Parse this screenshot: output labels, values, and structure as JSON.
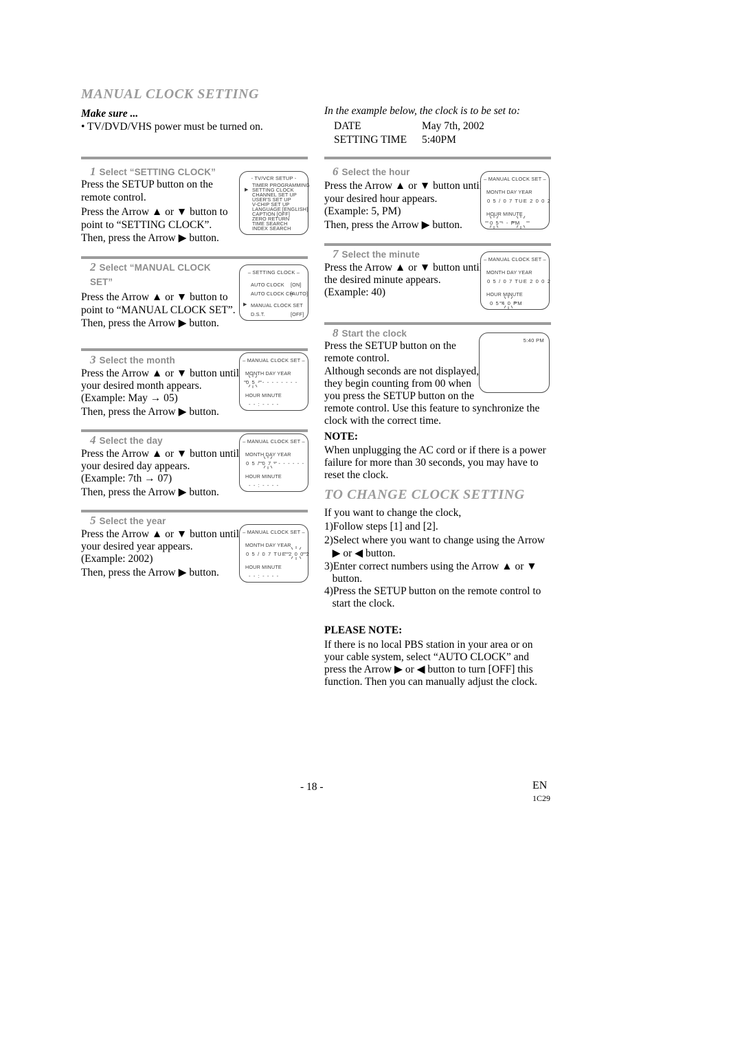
{
  "document": {
    "section_title": "MANUAL CLOCK SETTING",
    "make_sure_label": "Make sure ...",
    "make_sure_bullet": "• TV/DVD/VHS power must be turned on.",
    "example_lead": "In the example below, the clock is to be set to:",
    "example_rows": [
      {
        "label": "DATE",
        "value": "May 7th, 2002"
      },
      {
        "label": "SETTING TIME",
        "value": "5:40PM"
      }
    ]
  },
  "steps": [
    {
      "num": "1",
      "label": "Select “SETTING CLOCK”",
      "label_cont": "",
      "lines": [
        "Press the SETUP button on the",
        "remote control.",
        "Press the Arrow ▲ or ▼ button to",
        "point to “SETTING CLOCK”.",
        "Then, press the Arrow ▶ button."
      ]
    },
    {
      "num": "2",
      "label": "Select “MANUAL CLOCK",
      "label_cont": "SET”",
      "lines": [
        "Press the Arrow ▲ or ▼ button to",
        "point to “MANUAL CLOCK SET”.",
        "Then, press the Arrow ▶ button."
      ]
    },
    {
      "num": "3",
      "label": "Select the month",
      "label_cont": "",
      "lines": [
        "Press the Arrow ▲ or ▼ button until",
        "your desired month appears.",
        "(Example: May → 05)",
        "Then, press the Arrow ▶ button."
      ]
    },
    {
      "num": "4",
      "label": "Select the day",
      "label_cont": "",
      "lines": [
        "Press the Arrow ▲ or ▼ button until",
        "your desired day appears.",
        "(Example: 7th → 07)",
        "Then, press the Arrow ▶ button."
      ]
    },
    {
      "num": "5",
      "label": "Select the year",
      "label_cont": "",
      "lines": [
        "Press the Arrow ▲ or ▼ button until",
        "your desired year appears.",
        "(Example: 2002)",
        "Then, press the Arrow ▶ button."
      ]
    },
    {
      "num": "6",
      "label": "Select the hour",
      "label_cont": "",
      "lines": [
        "Press the Arrow ▲ or ▼ button until",
        "your desired hour appears.",
        "(Example: 5, PM)",
        "Then, press the Arrow ▶ button."
      ]
    },
    {
      "num": "7",
      "label": "Select the minute",
      "label_cont": "",
      "lines": [
        "Press the Arrow ▲ or ▼ button until",
        "the desired minute appears.",
        "(Example: 40)"
      ]
    },
    {
      "num": "8",
      "label": "Start the clock",
      "label_cont": "",
      "lines": [
        "Press the SETUP button on the",
        "remote control.",
        "Although seconds are not displayed,",
        "they begin counting from 00 when",
        "you press the SETUP button on the",
        "remote control. Use this feature to synchronize the",
        "clock with the correct time."
      ]
    }
  ],
  "osd": {
    "setup_menu": {
      "title": "- TV/VCR SETUP -",
      "items": [
        "TIMER PROGRAMMING",
        "SETTING CLOCK",
        "CHANNEL SET UP",
        "USER'S SET UP",
        "V-CHIP SET UP",
        "LANGUAGE  [ENGLISH]",
        "CAPTION  [OFF]",
        "ZERO RETURN",
        "TIME SEARCH",
        "INDEX SEARCH"
      ],
      "cursor_index": 1,
      "cursor_glyph": "▶"
    },
    "setting_clock_menu": {
      "title": "– SETTING CLOCK –",
      "rows": [
        {
          "name": "AUTO CLOCK",
          "value": "[ON]",
          "cursor": false
        },
        {
          "name": "AUTO CLOCK CH",
          "value": "[AUTO]",
          "cursor": false
        },
        {
          "name": "MANUAL CLOCK SET",
          "value": "",
          "cursor": true
        },
        {
          "name": "D.S.T.",
          "value": "[OFF]",
          "cursor": false
        }
      ],
      "cursor_glyph": "▶"
    },
    "manual_clock_set": {
      "title": "– MANUAL CLOCK SET –",
      "header_date": "MONTH  DAY              YEAR",
      "header_time": "HOUR    MINUTE",
      "month_step": {
        "date": "0 5    - -    - - -     - - - -",
        "time": "- -  :  - -    - -"
      },
      "day_step": {
        "date": "0 5  /  0 7    - - -     - - - -",
        "time": "- -  :  - -    - -"
      },
      "year_step": {
        "date": "0 5  /  0 7   TUE   2 0 0 2",
        "time": "- -  :  - -    - -"
      },
      "hour_step": {
        "date": "0 5  /  0 7   TUE   2 0 0 2",
        "time": "0 5    - -    PM"
      },
      "minute_step": {
        "date": "0 5  /  0 7   TUE   2 0 0 2",
        "time": "0 5    4 0    PM"
      }
    },
    "tv_screen": {
      "clock_display": "5:40 PM"
    }
  },
  "notes": {
    "note_title": "NOTE:",
    "note_lines": [
      "When unplugging the AC cord or if there is a power",
      "failure for more than 30 seconds, you may have to",
      "reset the clock."
    ],
    "change_title": "TO CHANGE CLOCK SETTING",
    "change_lines": [
      "If you want to change the clock,",
      "1)Follow steps [1] and [2].",
      "2)Select where you want to change using the Arrow",
      "   ▶ or ◀ button.",
      "3)Enter correct numbers using the Arrow ▲ or ▼",
      "   button.",
      "4)Press the SETUP button on the remote control to",
      "   start the clock."
    ],
    "please_note_title": "PLEASE NOTE:",
    "please_note_lines": [
      "If there is no local PBS station in your area or on",
      "your cable system, select “AUTO CLOCK” and",
      "press the Arrow ▶ or ◀ button to turn [OFF] this",
      "function. Then you can manually adjust the clock."
    ]
  },
  "footer": {
    "page_number": "- 18 -",
    "language_code": "EN",
    "doc_code": "1C29"
  }
}
